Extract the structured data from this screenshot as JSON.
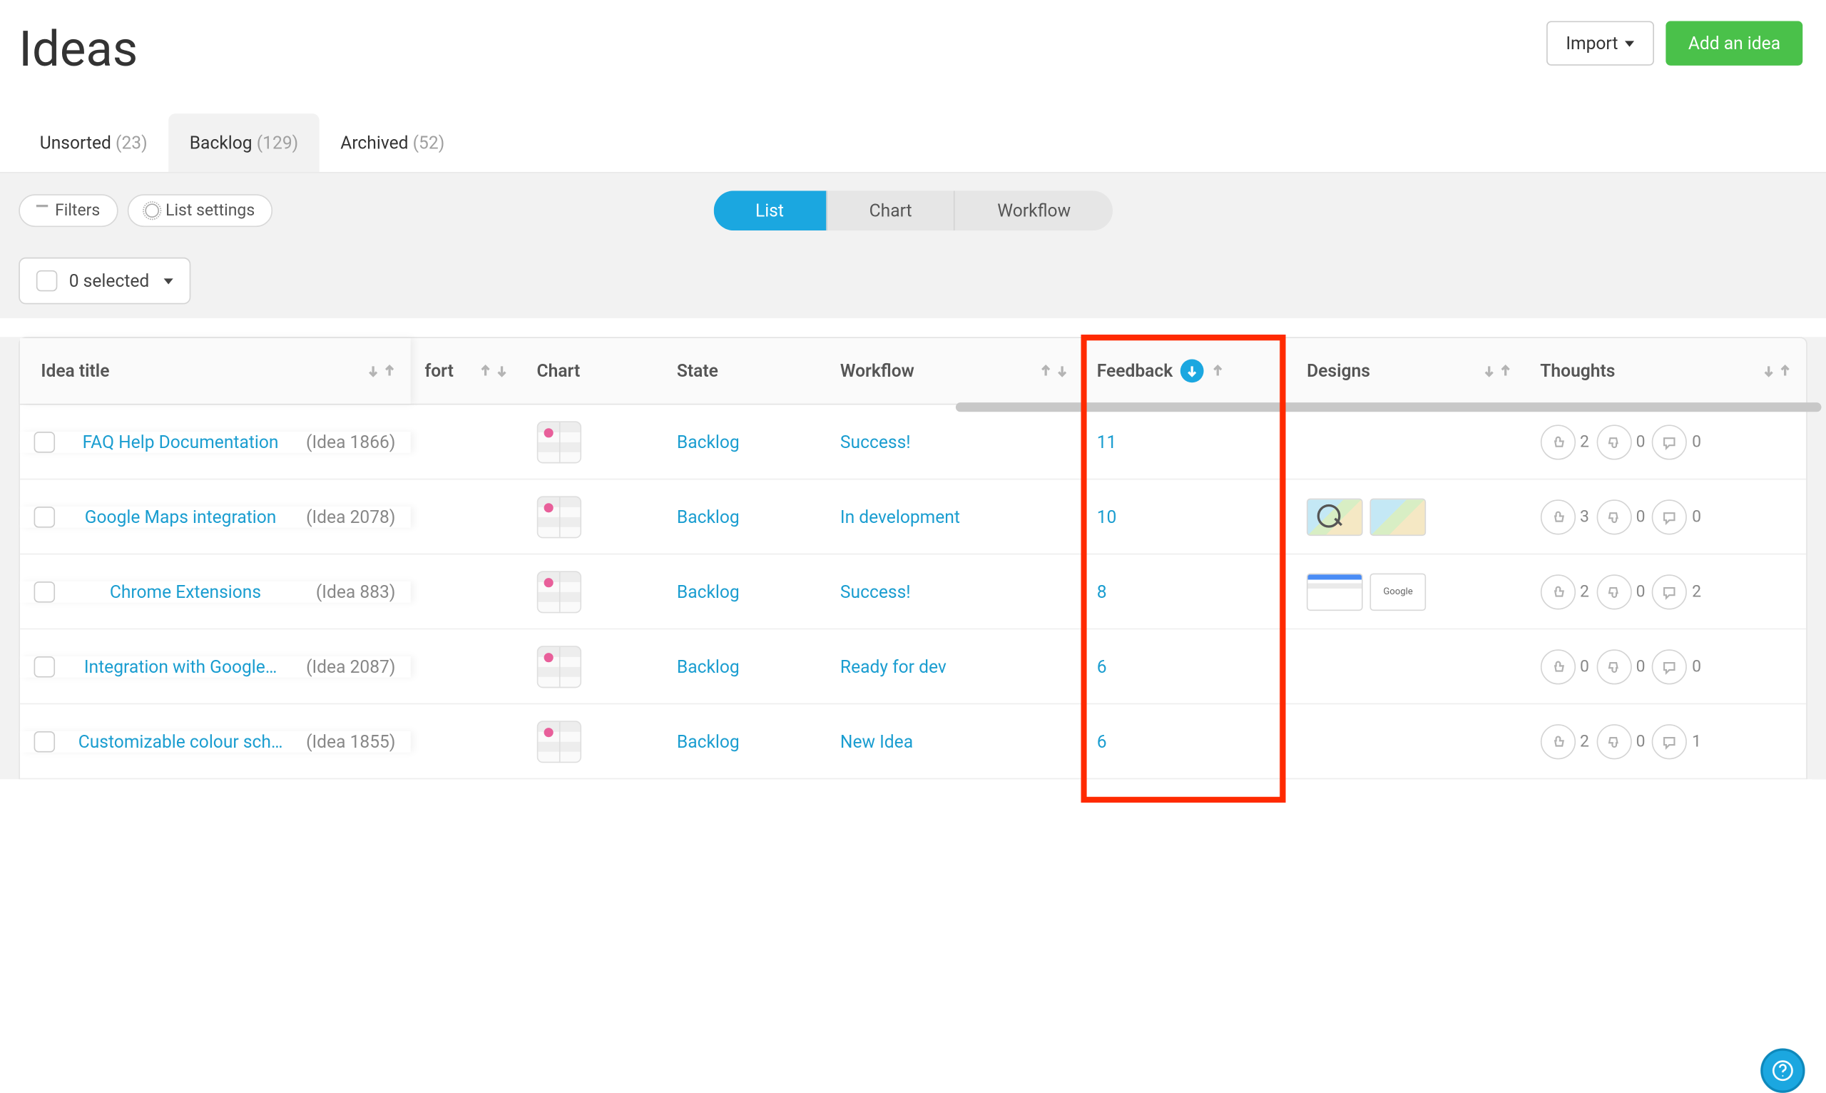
{
  "page": {
    "title": "Ideas"
  },
  "header": {
    "import_label": "Import",
    "add_label": "Add an idea"
  },
  "tabs": [
    {
      "label": "Unsorted",
      "count": "(23)",
      "active": false
    },
    {
      "label": "Backlog",
      "count": "(129)",
      "active": true
    },
    {
      "label": "Archived",
      "count": "(52)",
      "active": false
    }
  ],
  "controls": {
    "filters_label": "Filters",
    "list_settings_label": "List settings",
    "views": {
      "list": "List",
      "chart": "Chart",
      "workflow": "Workflow"
    },
    "selected_label": "0 selected"
  },
  "columns": {
    "title": "Idea title",
    "effort": "fort",
    "chart": "Chart",
    "state": "State",
    "workflow": "Workflow",
    "feedback": "Feedback",
    "designs": "Designs",
    "thoughts": "Thoughts"
  },
  "rows": [
    {
      "title": "FAQ Help Documentation",
      "id": "(Idea 1866)",
      "state": "Backlog",
      "workflow": "Success!",
      "feedback": "11",
      "designs": [],
      "thoughts": {
        "up": "2",
        "down": "0",
        "comment": "0"
      }
    },
    {
      "title": "Google Maps integration",
      "id": "(Idea 2078)",
      "state": "Backlog",
      "workflow": "In development",
      "feedback": "10",
      "designs": [
        "mag",
        "map"
      ],
      "thoughts": {
        "up": "3",
        "down": "0",
        "comment": "0"
      }
    },
    {
      "title": "Chrome Extensions",
      "id": "(Idea 883)",
      "state": "Backlog",
      "workflow": "Success!",
      "feedback": "8",
      "designs": [
        "web",
        "goog"
      ],
      "thoughts": {
        "up": "2",
        "down": "0",
        "comment": "2"
      }
    },
    {
      "title": "Integration with Google…",
      "id": "(Idea 2087)",
      "state": "Backlog",
      "workflow": "Ready for dev",
      "feedback": "6",
      "designs": [],
      "thoughts": {
        "up": "0",
        "down": "0",
        "comment": "0"
      }
    },
    {
      "title": "Customizable colour sch…",
      "id": "(Idea 1855)",
      "state": "Backlog",
      "workflow": "New Idea",
      "feedback": "6",
      "designs": [],
      "thoughts": {
        "up": "2",
        "down": "0",
        "comment": "1"
      }
    }
  ],
  "colors": {
    "accent": "#1ba7e0",
    "link": "#1a9dd0",
    "success": "#4ac14a",
    "highlight": "#ff2a00"
  }
}
